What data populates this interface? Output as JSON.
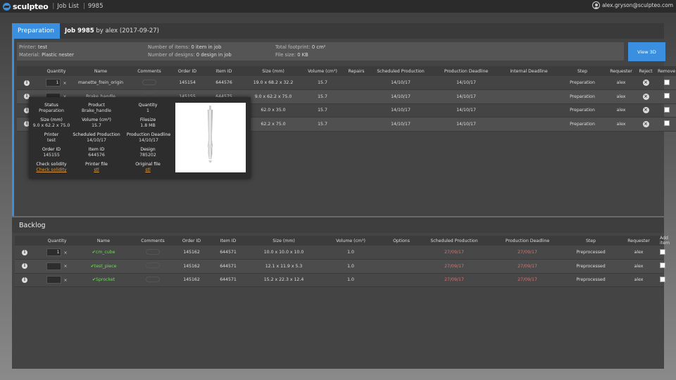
{
  "header": {
    "logo": "sculpteo",
    "crumb1": "Job List",
    "crumb2": "9985",
    "user": "alex.gryson@sculpteo.com"
  },
  "prep": {
    "tab": "Preparation",
    "job_label": "Job 9985",
    "job_by": "by alex",
    "job_date": "(2017-09-27)",
    "info": {
      "printer_label": "Printer:",
      "printer": "test",
      "material_label": "Material:",
      "material": "Plastic nester",
      "items_label": "Number of items:",
      "items": "0 item in job",
      "designs_label": "Number of designs:",
      "designs": "0 design in job",
      "footprint_label": "Total footprint:",
      "footprint": "0 cm²",
      "filesize_label": "File size:",
      "filesize": "0 KB"
    },
    "view3d": "View 3D",
    "columns": [
      "Quantity",
      "Name",
      "Comments",
      "Order ID",
      "Item ID",
      "Size (mm)",
      "Volume (cm³)",
      "Repairs",
      "Scheduled Production",
      "Production Deadline",
      "Internal Deadline",
      "Step",
      "Requester",
      "Reject",
      "Remove"
    ],
    "rows": [
      {
        "qty": "1",
        "name": "manette_frein_origin",
        "order": "145154",
        "item": "644576",
        "size": "19.0 x 68.2 x 32.2",
        "volume": "15.7",
        "sched": "14/10/17",
        "deadline": "14/10/17",
        "step": "Preparation",
        "req": "alex"
      },
      {
        "qty": "",
        "name": "Brake_handle",
        "order": "145155",
        "item": "644575",
        "size": "9.0 x 62.2 x 75.0",
        "volume": "15.7",
        "sched": "14/10/17",
        "deadline": "14/10/17",
        "step": "Preparation",
        "req": "alex"
      },
      {
        "qty": "",
        "name": "",
        "order": "",
        "item": "",
        "size": "62.0 x 35.0",
        "volume": "15.7",
        "sched": "14/10/17",
        "deadline": "14/10/17",
        "step": "Preparation",
        "req": "alex"
      },
      {
        "qty": "",
        "name": "",
        "order": "",
        "item": "",
        "size": "62.2 x 75.0",
        "volume": "15.7",
        "sched": "14/10/17",
        "deadline": "14/10/17",
        "step": "Preparation",
        "req": "alex"
      }
    ]
  },
  "popup": {
    "status_l": "Status",
    "status": "Preparation",
    "product_l": "Product",
    "product": "Brake_handle",
    "qty_l": "Quantity",
    "qty": "1",
    "size_l": "Size (mm)",
    "size": "9.0 x 62.2 x 75.0",
    "volume_l": "Volume (cm³)",
    "volume": "15.7",
    "filesize_l": "Filesize",
    "filesize": "1.8 MB",
    "printer_l": "Printer",
    "printer": "test",
    "sched_l": "Scheduled Production",
    "sched": "14/10/17",
    "deadline_l": "Production Deadline",
    "deadline": "14/10/17",
    "order_l": "Order ID",
    "order": "145155",
    "item_l": "Item ID",
    "item": "644576",
    "design_l": "Design",
    "design": "785202",
    "solidity_l": "Check solidity",
    "solidity": "Check solidity",
    "printerfile_l": "Printer file",
    "printerfile": "stl",
    "original_l": "Original file",
    "original": "stl"
  },
  "backlog": {
    "title": "Backlog",
    "columns": [
      "Quantity",
      "Name",
      "Comments",
      "Order ID",
      "Item ID",
      "Size (mm)",
      "Volume (cm³)",
      "Options",
      "Scheduled Production",
      "Production Deadline",
      "Step",
      "Requester",
      "Add item"
    ],
    "rows": [
      {
        "qty": "1",
        "name": "✔cm_cube",
        "order": "145162",
        "item": "644571",
        "size": "10.0 x 10.0 x 10.0",
        "volume": "1.0",
        "sched": "27/09/17",
        "deadline": "27/09/17",
        "step": "Preprocessed",
        "req": "alex"
      },
      {
        "qty": "",
        "name": "✔test_piece",
        "order": "145162",
        "item": "644571",
        "size": "12.1 x 11.9 x 5.3",
        "volume": "1.0",
        "sched": "27/09/17",
        "deadline": "27/09/17",
        "step": "Preprocessed",
        "req": "alex"
      },
      {
        "qty": "",
        "name": "✔Sprocket",
        "order": "145162",
        "item": "644571",
        "size": "15.2 x 22.3 x 12.4",
        "volume": "1.0",
        "sched": "27/09/17",
        "deadline": "27/09/17",
        "step": "Preprocessed",
        "req": "alex"
      }
    ]
  }
}
